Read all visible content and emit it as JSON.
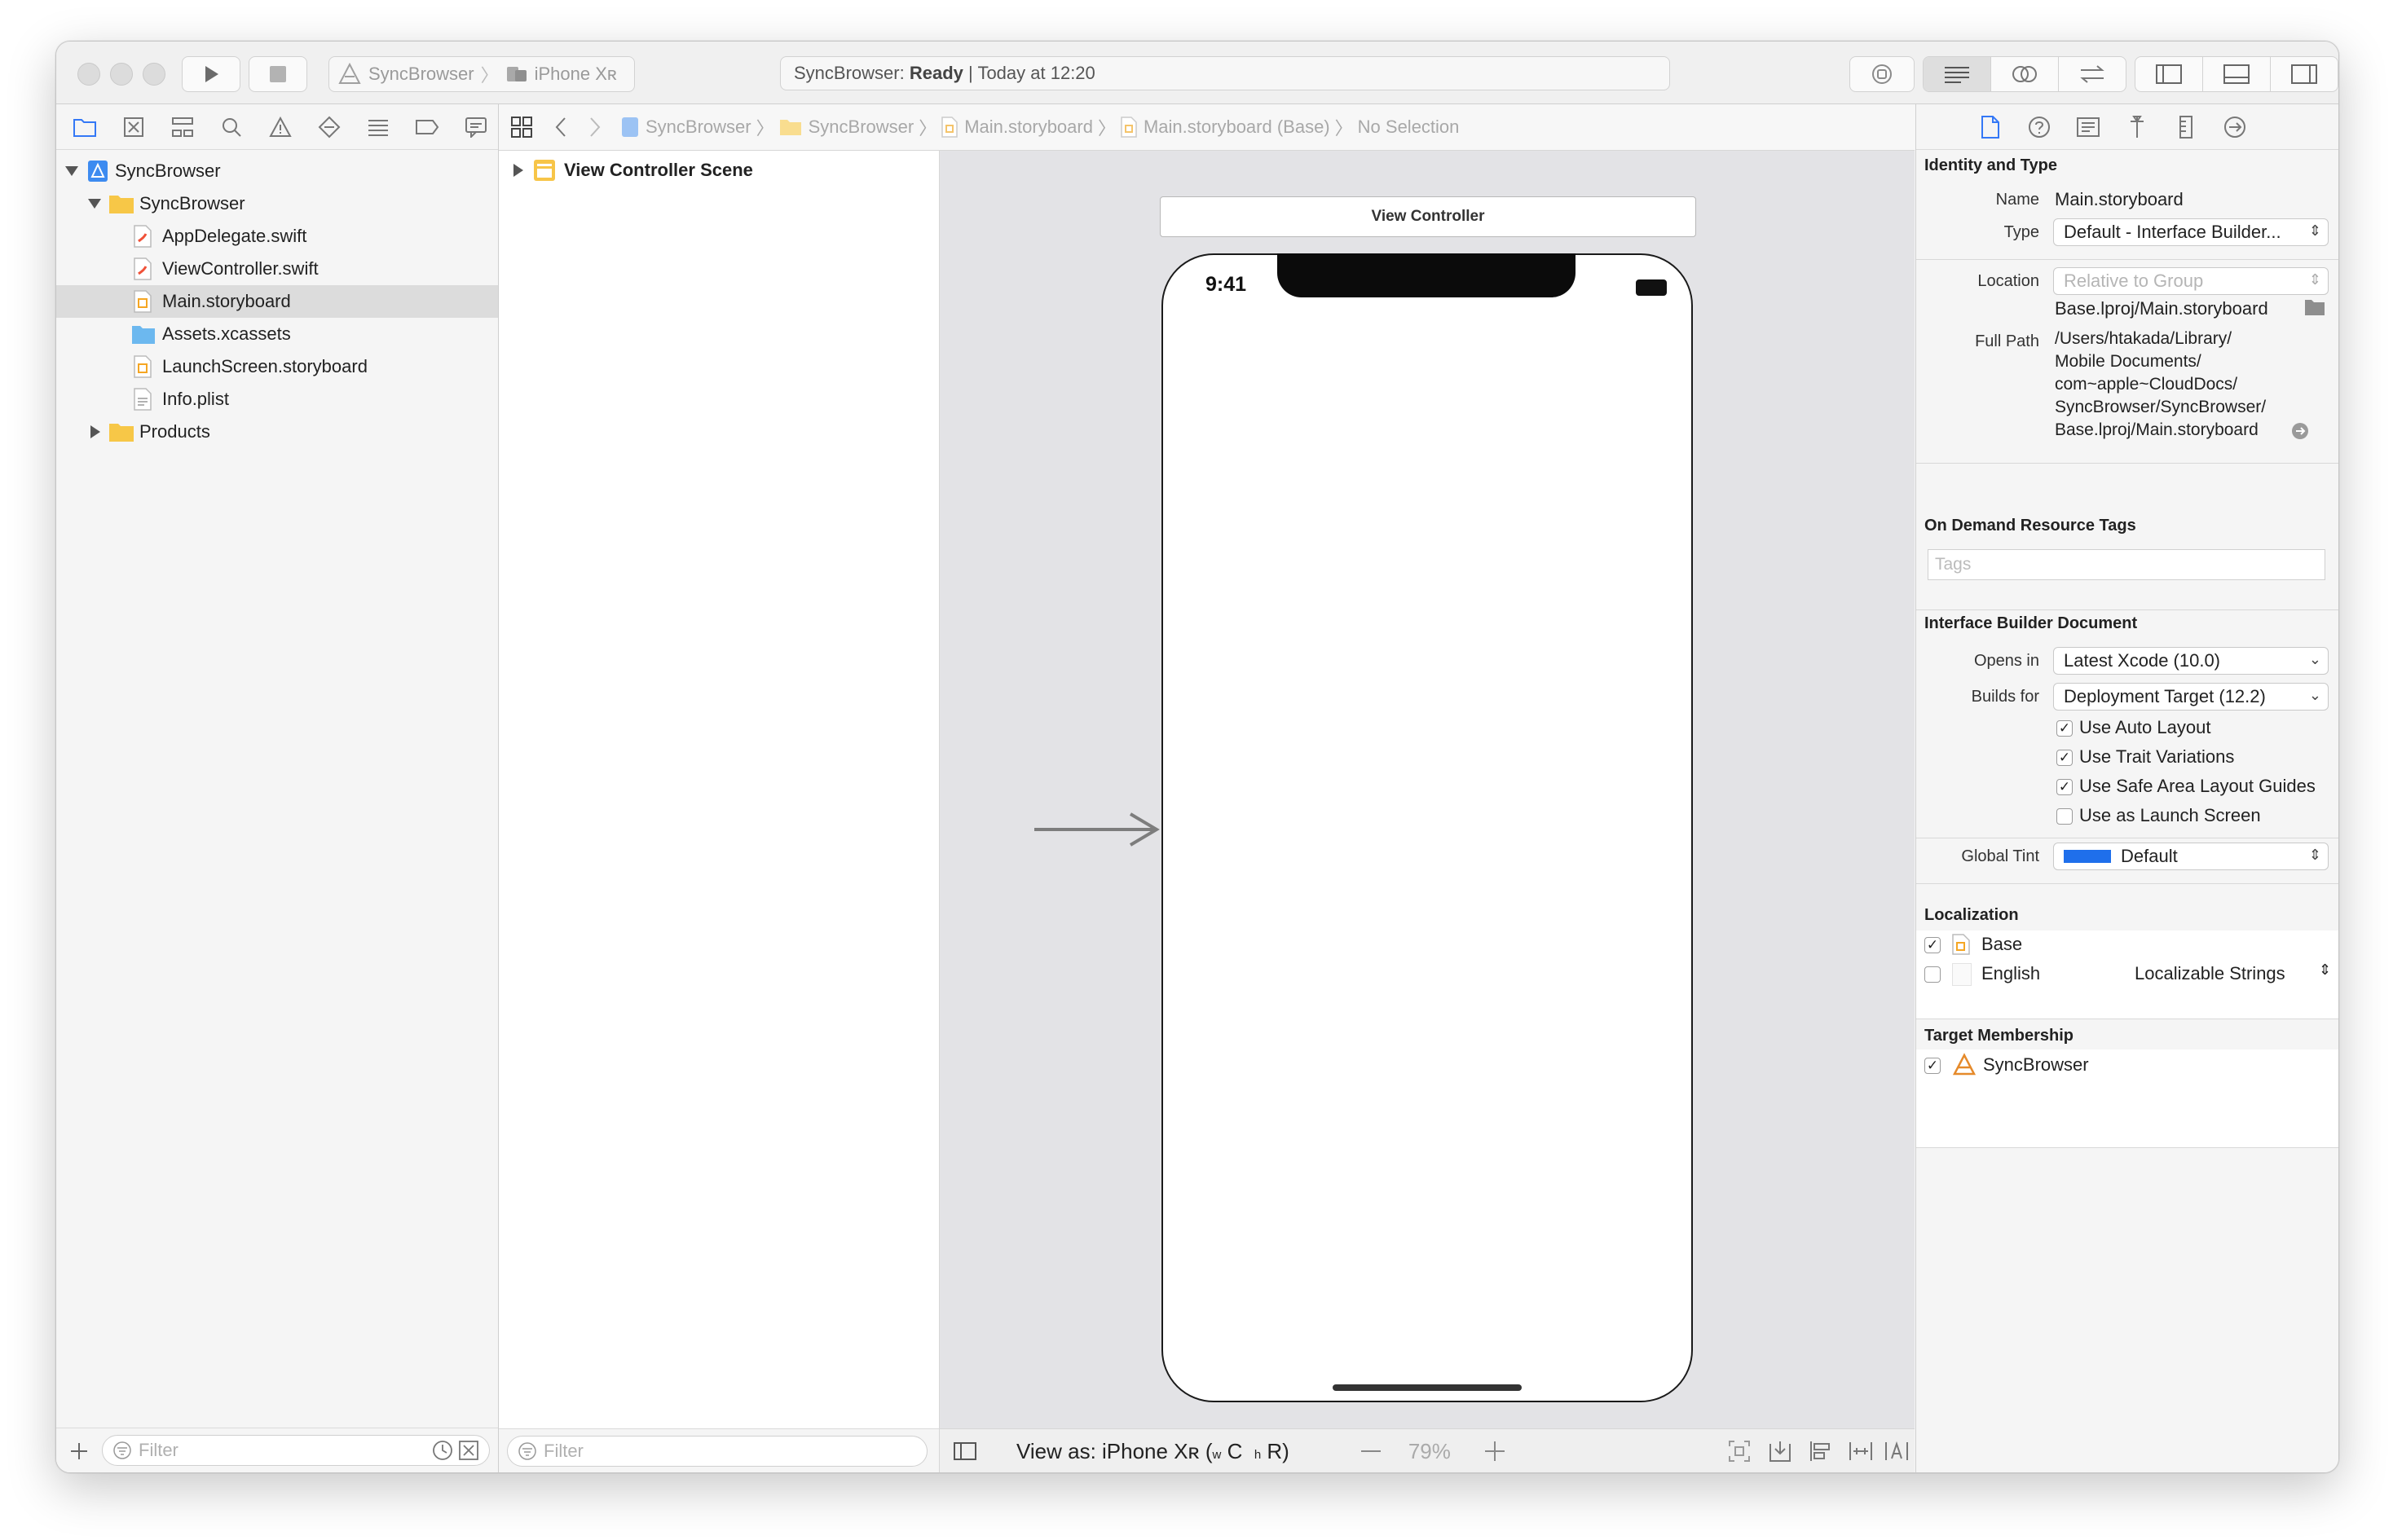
{
  "toolbar": {
    "scheme": "SyncBrowser",
    "destination": "iPhone Xʀ",
    "activity_project": "SyncBrowser:",
    "activity_status": "Ready",
    "activity_time": "| Today at 12:20"
  },
  "navigator": {
    "items": [
      {
        "label": "SyncBrowser",
        "icon": "project-icon"
      },
      {
        "label": "SyncBrowser",
        "icon": "folder-icon"
      },
      {
        "label": "AppDelegate.swift",
        "icon": "swift-file-icon"
      },
      {
        "label": "ViewController.swift",
        "icon": "swift-file-icon"
      },
      {
        "label": "Main.storyboard",
        "icon": "storyboard-icon"
      },
      {
        "label": "Assets.xcassets",
        "icon": "asset-catalog-icon"
      },
      {
        "label": "LaunchScreen.storyboard",
        "icon": "storyboard-icon"
      },
      {
        "label": "Info.plist",
        "icon": "plist-icon"
      },
      {
        "label": "Products",
        "icon": "folder-icon"
      }
    ],
    "filter_placeholder": "Filter"
  },
  "jumpbar": {
    "crumbs": [
      "SyncBrowser",
      "SyncBrowser",
      "Main.storyboard",
      "Main.storyboard (Base)",
      "No Selection"
    ]
  },
  "outline": {
    "scene_label": "View Controller Scene",
    "filter_placeholder": "Filter"
  },
  "canvas": {
    "vc_title": "View Controller",
    "status_time": "9:41",
    "view_as": "View as: iPhone Xʀ (",
    "size_class_w": "w",
    "size_class_C": "C",
    "size_class_h": "h",
    "size_class_R": "R)",
    "zoom": "79%"
  },
  "inspector": {
    "identity_header": "Identity and Type",
    "name_label": "Name",
    "name_value": "Main.storyboard",
    "type_label": "Type",
    "type_value": "Default - Interface Builder...",
    "location_label": "Location",
    "location_value": "Relative to Group",
    "location_path": "Base.lproj/Main.storyboard",
    "fullpath_label": "Full Path",
    "fullpath_lines": [
      "/Users/htakada/Library/",
      "Mobile Documents/",
      "com~apple~CloudDocs/",
      "SyncBrowser/SyncBrowser/",
      "Base.lproj/Main.storyboard"
    ],
    "odr_header": "On Demand Resource Tags",
    "tags_placeholder": "Tags",
    "ibd_header": "Interface Builder Document",
    "opens_in_label": "Opens in",
    "opens_in_value": "Latest Xcode (10.0)",
    "builds_for_label": "Builds for",
    "builds_for_value": "Deployment Target (12.2)",
    "checks": [
      {
        "label": "Use Auto Layout",
        "checked": true
      },
      {
        "label": "Use Trait Variations",
        "checked": true
      },
      {
        "label": "Use Safe Area Layout Guides",
        "checked": true
      },
      {
        "label": "Use as Launch Screen",
        "checked": false
      }
    ],
    "global_tint_label": "Global Tint",
    "global_tint_value": "Default",
    "global_tint_color": "#1f6feb",
    "localization_header": "Localization",
    "loc_base": "Base",
    "loc_english": "English",
    "loc_english_type": "Localizable Strings",
    "target_header": "Target Membership",
    "target_name": "SyncBrowser"
  }
}
